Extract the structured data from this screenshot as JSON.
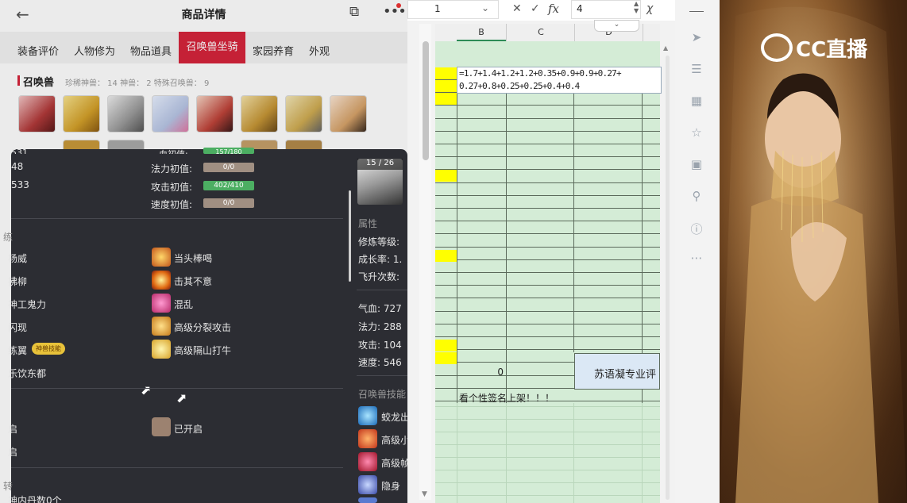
{
  "app": {
    "title": "商品详情",
    "tabs": [
      "装备评价",
      "人物修为",
      "物品道具",
      "召唤兽坐骑",
      "家园养育",
      "外观"
    ],
    "active_tab": "召唤兽坐骑",
    "section_title": "召唤兽",
    "section_stats": "珍稀神兽： 14   神兽： 2   特殊召唤兽： 9",
    "panel": {
      "stats_left_partial": [
        "48",
        "533"
      ],
      "stat_labels": [
        "法力初值:",
        "攻击初值:",
        "速度初值:"
      ],
      "stat_values": [
        "0/0",
        "402/410",
        "0/0"
      ],
      "top_partial_label": "血初值:",
      "top_partial_value": "157/180",
      "top_partial_left": "531",
      "skills_left": [
        "杨威",
        "拂柳",
        "神工鬼力",
        "闪现",
        "练翼",
        "乐饮东都"
      ],
      "skill_badge": "神兽技能",
      "skills_right": [
        "当头棒喝",
        "击其不意",
        "混乱",
        "高级分裂攻击",
        "高级隔山打牛"
      ],
      "partial_sec": "练",
      "row_open_left": [
        "启",
        "启"
      ],
      "opened_label": "已开启",
      "bottom_partial": "神内丹数0个",
      "bottom_partial2": "转",
      "side": {
        "counter": "15 / 26",
        "attr_title": "属性",
        "attrs": [
          "修炼等级:",
          "成长率: 1.",
          "飞升次数:"
        ],
        "values": [
          "气血: 727",
          "法力: 288",
          "攻击: 104",
          "速度: 546"
        ],
        "skill_title": "召唤兽技能",
        "skills": [
          "蛟龙出",
          "高级小",
          "高级帧",
          "隐身"
        ]
      }
    }
  },
  "sheet": {
    "name_box": "",
    "formula_value": "4",
    "columns": [
      "B",
      "C",
      "D"
    ],
    "formula_line1": "=1.7+1.4+1.2+1.2+0.35+0.9+0.9+0.27+",
    "formula_line2": "0.27+0.8+0.25+0.25+0.4+0.4",
    "zero_value": "0",
    "merged_text": "苏语凝专业评",
    "bottom_text": "看个性签名上架！！！"
  },
  "watermark": "CC直播",
  "colors": {
    "accent": "#d6243b",
    "sheet_green": "#d4ecd6",
    "highlight_yellow": "#ffff00",
    "bar_green": "#4cae62",
    "panel_bg": "#2c2d33"
  }
}
